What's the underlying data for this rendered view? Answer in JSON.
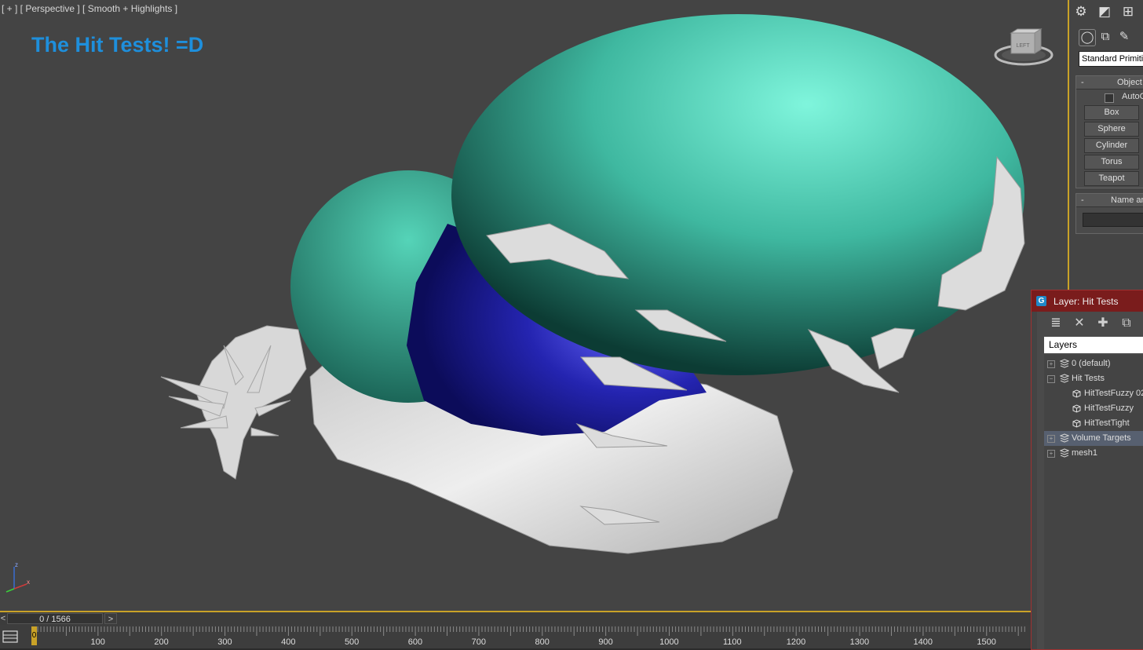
{
  "viewport": {
    "label": "[ + ] [ Perspective ] [ Smooth + Highlights ]",
    "title": "The Hit Tests! =D",
    "viewcube_label": "LEFT",
    "axis_labels": [
      "z",
      "x"
    ]
  },
  "command_panel": {
    "dropdown_value": "Standard Primitiv",
    "object_type_title": "Object",
    "autogrid_label": "AutoG",
    "primitives": [
      "Box",
      "Sphere",
      "Cylinder",
      "Torus",
      "Teapot"
    ],
    "name_rollout_title": "Name an"
  },
  "layer_dialog": {
    "title": "Layer: Hit Tests",
    "column_header": "Layers",
    "rows": [
      {
        "label": "0 (default)",
        "kind": "layer",
        "expander": "+"
      },
      {
        "label": "Hit Tests",
        "kind": "layer",
        "expander": "−"
      },
      {
        "label": "HitTestFuzzy 02",
        "kind": "object"
      },
      {
        "label": "HitTestFuzzy",
        "kind": "object"
      },
      {
        "label": "HitTestTight",
        "kind": "object"
      },
      {
        "label": "Volume Targets",
        "kind": "layer",
        "expander": "+",
        "selected": true
      },
      {
        "label": "mesh1",
        "kind": "layer",
        "expander": "+"
      }
    ]
  },
  "timeline": {
    "frame_display": "0 / 1566",
    "prev": "<",
    "next": ">",
    "current_frame": "0",
    "ticks": [
      "100",
      "200",
      "300",
      "400",
      "500",
      "600",
      "700",
      "800",
      "900",
      "1000",
      "1100",
      "1200",
      "1300",
      "1400",
      "1500"
    ]
  },
  "colors": {
    "accent": "#c9a227",
    "title_blue": "#1e8fdc",
    "teal": "#3fc0a8",
    "dark_blue": "#2a2aa8",
    "dialog_title": "#7a1c1c"
  },
  "icons": [
    "gear-icon",
    "modify-icon",
    "hierarchy-icon",
    "sphere-category-icon",
    "shapes-icon",
    "lights-icon",
    "new-layer-icon",
    "delete-icon",
    "add-icon",
    "select-icon",
    "layer-icon",
    "object-icon",
    "timeline-config-icon"
  ]
}
